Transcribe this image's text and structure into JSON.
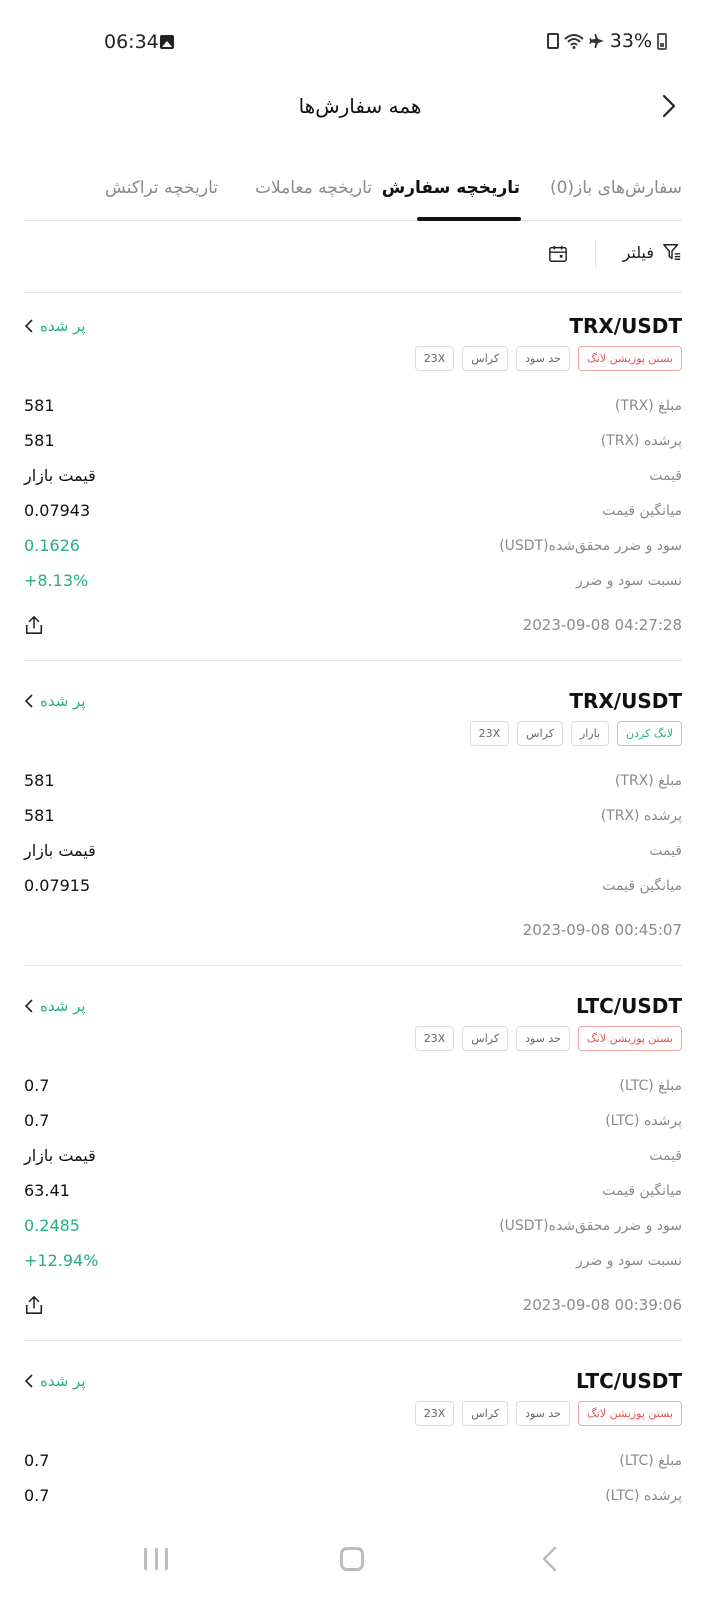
{
  "status_bar": {
    "time": "06:34",
    "battery": "33%"
  },
  "header": {
    "title": "همه سفارش‌ها"
  },
  "tabs": [
    {
      "label": "سفارش‌های باز(0)",
      "active": false
    },
    {
      "label": "تاریخچه سفارش",
      "active": true
    },
    {
      "label": "تاریخچه معاملات",
      "active": false
    },
    {
      "label": "تاریخچه تراکنش",
      "active": false
    }
  ],
  "filter": {
    "label": "فیلتر"
  },
  "orders": [
    {
      "pair": "TRX/USDT",
      "status": "پر شده",
      "tags": [
        {
          "text": "بستن پوزیشن لانگ",
          "color": "red"
        },
        {
          "text": "حد سود",
          "color": "grey"
        },
        {
          "text": "کراس",
          "color": "grey"
        },
        {
          "text": "23X",
          "color": "grey"
        }
      ],
      "rows": [
        {
          "label": "مبلغ (TRX)",
          "value": "581"
        },
        {
          "label": "پرشده (TRX)",
          "value": "581"
        },
        {
          "label": "قیمت",
          "value": "قیمت بازار"
        },
        {
          "label": "میانگین قیمت",
          "value": "0.07943"
        },
        {
          "label": "سود و ضرر محقق‌شده(USDT)",
          "value": "0.1626",
          "color": "green"
        },
        {
          "label": "نسبت سود و ضرر",
          "value": "+8.13%",
          "color": "green"
        }
      ],
      "date": "2023-09-08 04:27:28",
      "share": true
    },
    {
      "pair": "TRX/USDT",
      "status": "پر شده",
      "tags": [
        {
          "text": "لانگ کردن",
          "color": "green"
        },
        {
          "text": "بازار",
          "color": "grey"
        },
        {
          "text": "کراس",
          "color": "grey"
        },
        {
          "text": "23X",
          "color": "grey"
        }
      ],
      "rows": [
        {
          "label": "مبلغ (TRX)",
          "value": "581"
        },
        {
          "label": "پرشده (TRX)",
          "value": "581"
        },
        {
          "label": "قیمت",
          "value": "قیمت بازار"
        },
        {
          "label": "میانگین قیمت",
          "value": "0.07915"
        }
      ],
      "date": "2023-09-08 00:45:07",
      "share": false
    },
    {
      "pair": "LTC/USDT",
      "status": "پر شده",
      "tags": [
        {
          "text": "بستن پوزیشن لانگ",
          "color": "red"
        },
        {
          "text": "حد سود",
          "color": "grey"
        },
        {
          "text": "کراس",
          "color": "grey"
        },
        {
          "text": "23X",
          "color": "grey"
        }
      ],
      "rows": [
        {
          "label": "مبلغ (LTC)",
          "value": "0.7"
        },
        {
          "label": "پرشده (LTC)",
          "value": "0.7"
        },
        {
          "label": "قیمت",
          "value": "قیمت بازار"
        },
        {
          "label": "میانگین قیمت",
          "value": "63.41"
        },
        {
          "label": "سود و ضرر محقق‌شده(USDT)",
          "value": "0.2485",
          "color": "green"
        },
        {
          "label": "نسبت سود و ضرر",
          "value": "+12.94%",
          "color": "green"
        }
      ],
      "date": "2023-09-08 00:39:06",
      "share": true
    },
    {
      "pair": "LTC/USDT",
      "status": "پر شده",
      "tags": [
        {
          "text": "بستن پوزیشن لانگ",
          "color": "red"
        },
        {
          "text": "حد سود",
          "color": "grey"
        },
        {
          "text": "کراس",
          "color": "grey"
        },
        {
          "text": "23X",
          "color": "grey"
        }
      ],
      "rows": [
        {
          "label": "مبلغ (LTC)",
          "value": "0.7"
        },
        {
          "label": "پرشده (LTC)",
          "value": "0.7"
        }
      ],
      "date": "",
      "share": false
    }
  ],
  "colors": {
    "green": "#25b17e",
    "red": "#e25454",
    "muted": "#8a8a8a"
  }
}
